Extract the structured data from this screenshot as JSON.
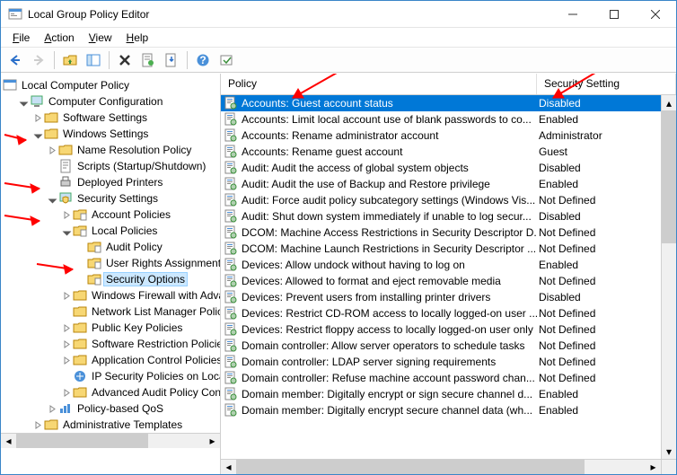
{
  "window": {
    "title": "Local Group Policy Editor"
  },
  "menu": {
    "file": "File",
    "action": "Action",
    "view": "View",
    "help": "Help"
  },
  "tree_root": "Local Computer Policy",
  "tree": [
    {
      "label": "Computer Configuration",
      "depth": 1,
      "icon": "computer",
      "exp": "open"
    },
    {
      "label": "Software Settings",
      "depth": 2,
      "icon": "folder",
      "exp": "closed"
    },
    {
      "label": "Windows Settings",
      "depth": 2,
      "icon": "folder",
      "exp": "open",
      "mark": true
    },
    {
      "label": "Name Resolution Policy",
      "depth": 3,
      "icon": "folder",
      "exp": "closed"
    },
    {
      "label": "Scripts (Startup/Shutdown)",
      "depth": 3,
      "icon": "script",
      "exp": "none"
    },
    {
      "label": "Deployed Printers",
      "depth": 3,
      "icon": "printer",
      "exp": "none"
    },
    {
      "label": "Security Settings",
      "depth": 3,
      "icon": "security",
      "exp": "open",
      "mark": true
    },
    {
      "label": "Account Policies",
      "depth": 4,
      "icon": "policyf",
      "exp": "closed"
    },
    {
      "label": "Local Policies",
      "depth": 4,
      "icon": "policyf",
      "exp": "open",
      "mark": true
    },
    {
      "label": "Audit Policy",
      "depth": 5,
      "icon": "policyf",
      "exp": "none"
    },
    {
      "label": "User Rights Assignment",
      "depth": 5,
      "icon": "policyf",
      "exp": "none"
    },
    {
      "label": "Security Options",
      "depth": 5,
      "icon": "policyf",
      "exp": "none",
      "sel": true,
      "mark": true
    },
    {
      "label": "Windows Firewall with Advanced Security",
      "depth": 4,
      "icon": "folder",
      "exp": "closed"
    },
    {
      "label": "Network List Manager Policies",
      "depth": 4,
      "icon": "folder",
      "exp": "none"
    },
    {
      "label": "Public Key Policies",
      "depth": 4,
      "icon": "folder",
      "exp": "closed"
    },
    {
      "label": "Software Restriction Policies",
      "depth": 4,
      "icon": "folder",
      "exp": "closed"
    },
    {
      "label": "Application Control Policies",
      "depth": 4,
      "icon": "folder",
      "exp": "closed"
    },
    {
      "label": "IP Security Policies on Local Computer",
      "depth": 4,
      "icon": "ipsec",
      "exp": "none"
    },
    {
      "label": "Advanced Audit Policy Configuration",
      "depth": 4,
      "icon": "folder",
      "exp": "closed"
    },
    {
      "label": "Policy-based QoS",
      "depth": 3,
      "icon": "qos",
      "exp": "closed"
    },
    {
      "label": "Administrative Templates",
      "depth": 2,
      "icon": "folder",
      "exp": "closed"
    }
  ],
  "list_header": {
    "policy": "Policy",
    "setting": "Security Setting"
  },
  "policies": [
    {
      "name": "Accounts: Guest account status",
      "setting": "Disabled",
      "sel": true
    },
    {
      "name": "Accounts: Limit local account use of blank passwords to co...",
      "setting": "Enabled"
    },
    {
      "name": "Accounts: Rename administrator account",
      "setting": "Administrator"
    },
    {
      "name": "Accounts: Rename guest account",
      "setting": "Guest"
    },
    {
      "name": "Audit: Audit the access of global system objects",
      "setting": "Disabled"
    },
    {
      "name": "Audit: Audit the use of Backup and Restore privilege",
      "setting": "Enabled"
    },
    {
      "name": "Audit: Force audit policy subcategory settings (Windows Vis...",
      "setting": "Not Defined"
    },
    {
      "name": "Audit: Shut down system immediately if unable to log secur...",
      "setting": "Disabled"
    },
    {
      "name": "DCOM: Machine Access Restrictions in Security Descriptor D...",
      "setting": "Not Defined"
    },
    {
      "name": "DCOM: Machine Launch Restrictions in Security Descriptor ...",
      "setting": "Not Defined"
    },
    {
      "name": "Devices: Allow undock without having to log on",
      "setting": "Enabled"
    },
    {
      "name": "Devices: Allowed to format and eject removable media",
      "setting": "Not Defined"
    },
    {
      "name": "Devices: Prevent users from installing printer drivers",
      "setting": "Disabled"
    },
    {
      "name": "Devices: Restrict CD-ROM access to locally logged-on user ...",
      "setting": "Not Defined"
    },
    {
      "name": "Devices: Restrict floppy access to locally logged-on user only",
      "setting": "Not Defined"
    },
    {
      "name": "Domain controller: Allow server operators to schedule tasks",
      "setting": "Not Defined"
    },
    {
      "name": "Domain controller: LDAP server signing requirements",
      "setting": "Not Defined"
    },
    {
      "name": "Domain controller: Refuse machine account password chan...",
      "setting": "Not Defined"
    },
    {
      "name": "Domain member: Digitally encrypt or sign secure channel d...",
      "setting": "Enabled"
    },
    {
      "name": "Domain member: Digitally encrypt secure channel data (wh...",
      "setting": "Enabled"
    }
  ]
}
